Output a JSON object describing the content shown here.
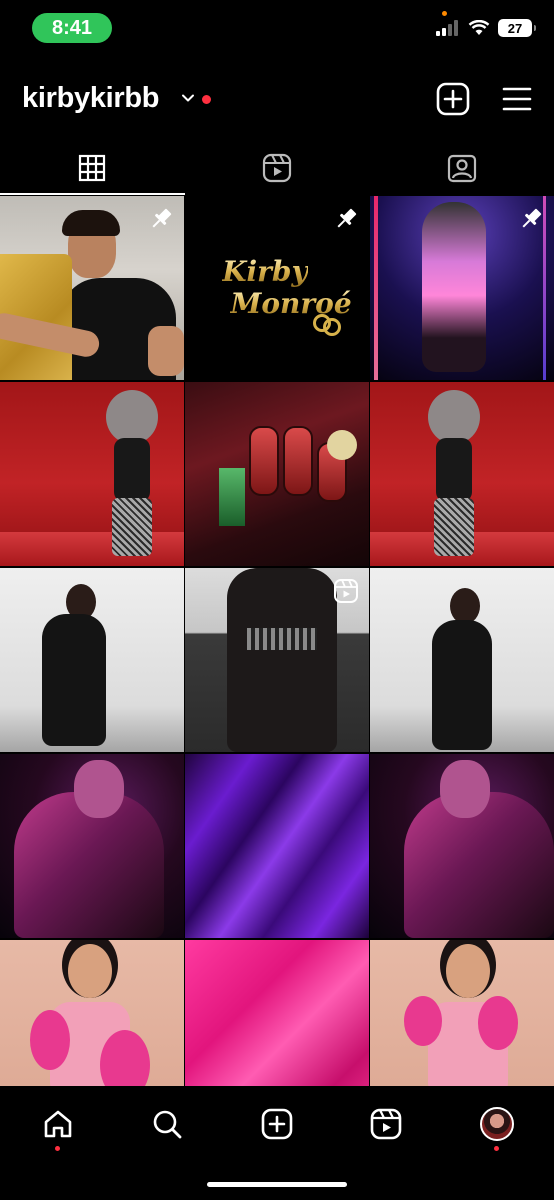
{
  "status_bar": {
    "time": "8:41",
    "battery_level": "27",
    "icons": [
      "signal-icon",
      "wifi-icon",
      "battery-icon"
    ]
  },
  "header": {
    "username": "kirbykirbb",
    "icons": [
      "chevron-down-icon",
      "create-post-icon",
      "menu-icon"
    ],
    "notification_dot_color": "#ff3040"
  },
  "tabs": [
    {
      "name": "posts",
      "icon": "grid-icon",
      "active": true
    },
    {
      "name": "reels",
      "icon": "reels-icon",
      "active": false
    },
    {
      "name": "tagged",
      "icon": "tagged-icon",
      "active": false
    }
  ],
  "grid": {
    "logo_post": {
      "line1": "Kirby",
      "line2": "Monroé"
    },
    "tiles": [
      {
        "name": "selfie-post",
        "pinned": true
      },
      {
        "name": "kirby-monroe-logo-post",
        "pinned": true
      },
      {
        "name": "neon-stage-post",
        "pinned": true
      },
      {
        "name": "red-room-post-1"
      },
      {
        "name": "casino-slot-post"
      },
      {
        "name": "red-room-post-2"
      },
      {
        "name": "white-wall-post-1"
      },
      {
        "name": "street-outfit-reel",
        "reel": true
      },
      {
        "name": "white-wall-post-2"
      },
      {
        "name": "purple-light-post-1"
      },
      {
        "name": "purple-satin-post"
      },
      {
        "name": "purple-light-post-2"
      },
      {
        "name": "pink-feather-post-1"
      },
      {
        "name": "pink-fabric-post"
      },
      {
        "name": "pink-feather-post-2"
      }
    ]
  },
  "bottom_nav": {
    "items": [
      "home-icon",
      "search-icon",
      "create-icon",
      "reels-icon",
      "profile-avatar"
    ],
    "accent": "#ff3040"
  },
  "colors": {
    "background": "#000000",
    "status_pill": "#30c55a"
  }
}
